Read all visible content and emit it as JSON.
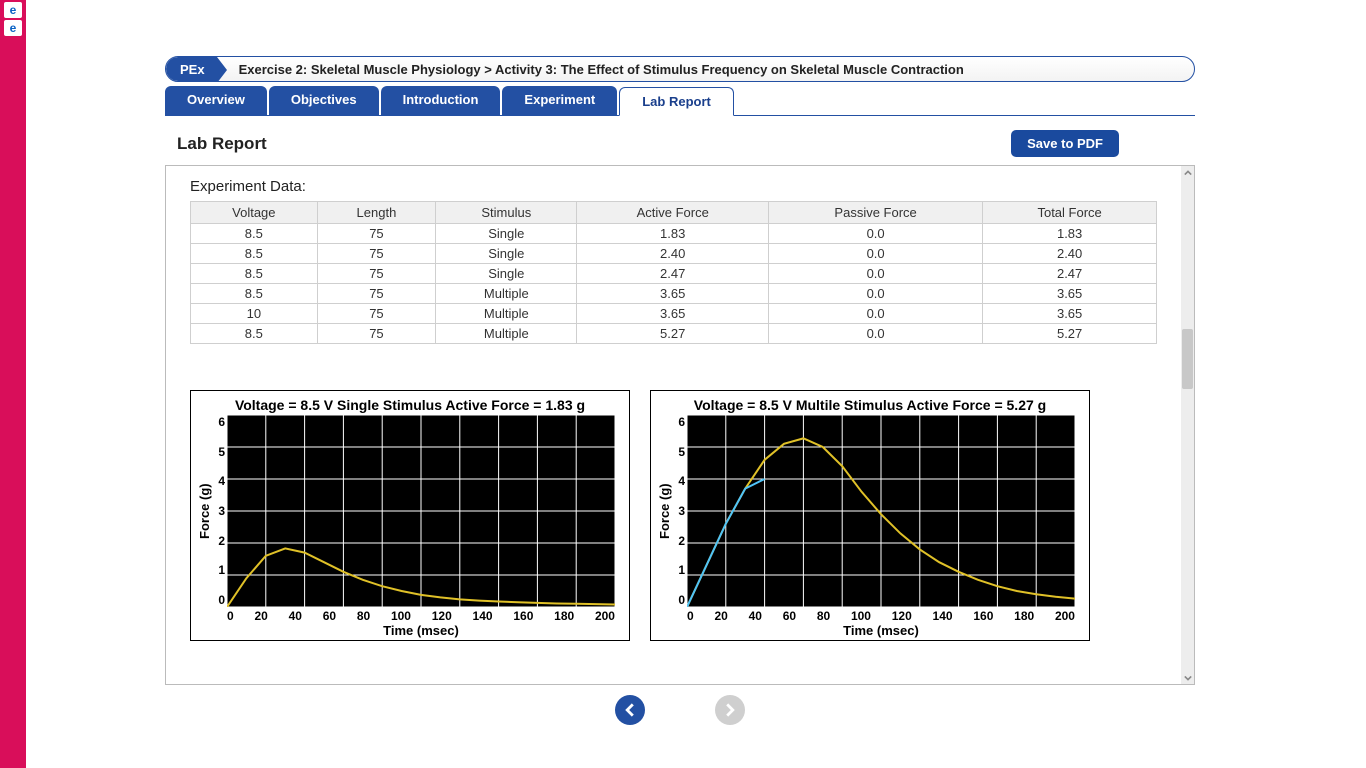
{
  "breadcrumb": {
    "badge": "PEx",
    "text": "Exercise 2: Skeletal Muscle Physiology > Activity 3: The Effect of Stimulus Frequency on Skeletal Muscle Contraction"
  },
  "tabs": {
    "overview": "Overview",
    "objectives": "Objectives",
    "introduction": "Introduction",
    "experiment": "Experiment",
    "lab_report": "Lab Report"
  },
  "page_title": "Lab Report",
  "save_btn": "Save to PDF",
  "experiment_data_title": "Experiment Data:",
  "table": {
    "headers": [
      "Voltage",
      "Length",
      "Stimulus",
      "Active Force",
      "Passive Force",
      "Total Force"
    ],
    "rows": [
      [
        "8.5",
        "75",
        "Single",
        "1.83",
        "0.0",
        "1.83"
      ],
      [
        "8.5",
        "75",
        "Single",
        "2.40",
        "0.0",
        "2.40"
      ],
      [
        "8.5",
        "75",
        "Single",
        "2.47",
        "0.0",
        "2.47"
      ],
      [
        "8.5",
        "75",
        "Multiple",
        "3.65",
        "0.0",
        "3.65"
      ],
      [
        "10",
        "75",
        "Multiple",
        "3.65",
        "0.0",
        "3.65"
      ],
      [
        "8.5",
        "75",
        "Multiple",
        "5.27",
        "0.0",
        "5.27"
      ]
    ]
  },
  "chart1": {
    "title": "Voltage = 8.5 V Single Stimulus Active Force = 1.83 g",
    "ylabel": "Force (g)",
    "xlabel": "Time (msec)",
    "yticks": [
      "6",
      "5",
      "4",
      "3",
      "2",
      "1",
      "0"
    ],
    "xticks": [
      "0",
      "20",
      "40",
      "60",
      "80",
      "100",
      "120",
      "140",
      "160",
      "180",
      "200"
    ]
  },
  "chart2": {
    "title": "Voltage = 8.5 V Multile Stimulus Active Force = 5.27 g",
    "ylabel": "Force (g)",
    "xlabel": "Time (msec)",
    "yticks": [
      "6",
      "5",
      "4",
      "3",
      "2",
      "1",
      "0"
    ],
    "xticks": [
      "0",
      "20",
      "40",
      "60",
      "80",
      "100",
      "120",
      "140",
      "160",
      "180",
      "200"
    ]
  },
  "chart_data": [
    {
      "type": "line",
      "title": "Voltage = 8.5 V Single Stimulus Active Force = 1.83 g",
      "xlabel": "Time (msec)",
      "ylabel": "Force (g)",
      "xlim": [
        0,
        200
      ],
      "ylim": [
        0,
        6
      ],
      "x": [
        0,
        10,
        20,
        30,
        40,
        50,
        60,
        70,
        80,
        90,
        100,
        110,
        120,
        130,
        140,
        150,
        160,
        170,
        180,
        190,
        200
      ],
      "series": [
        {
          "name": "force",
          "color": "#e0c128",
          "values": [
            0,
            0.9,
            1.6,
            1.83,
            1.7,
            1.4,
            1.1,
            0.85,
            0.65,
            0.5,
            0.38,
            0.3,
            0.24,
            0.2,
            0.17,
            0.15,
            0.13,
            0.11,
            0.1,
            0.09,
            0.08
          ]
        }
      ]
    },
    {
      "type": "line",
      "title": "Voltage = 8.5 V Multile Stimulus Active Force = 5.27 g",
      "xlabel": "Time (msec)",
      "ylabel": "Force (g)",
      "xlim": [
        0,
        200
      ],
      "ylim": [
        0,
        6
      ],
      "x": [
        0,
        10,
        20,
        30,
        40,
        50,
        60,
        70,
        80,
        90,
        100,
        110,
        120,
        130,
        140,
        150,
        160,
        170,
        180,
        190,
        200
      ],
      "series": [
        {
          "name": "force",
          "color": "#e0c128",
          "values": [
            0,
            1.3,
            2.6,
            3.7,
            4.6,
            5.1,
            5.27,
            5.0,
            4.4,
            3.6,
            2.9,
            2.3,
            1.8,
            1.4,
            1.1,
            0.85,
            0.65,
            0.5,
            0.4,
            0.32,
            0.26
          ]
        },
        {
          "name": "rise-overlay",
          "color": "#4fc3f7",
          "values": [
            0,
            1.3,
            2.6,
            3.7,
            4.0,
            null,
            null,
            null,
            null,
            null,
            null,
            null,
            null,
            null,
            null,
            null,
            null,
            null,
            null,
            null,
            null
          ]
        }
      ]
    }
  ]
}
